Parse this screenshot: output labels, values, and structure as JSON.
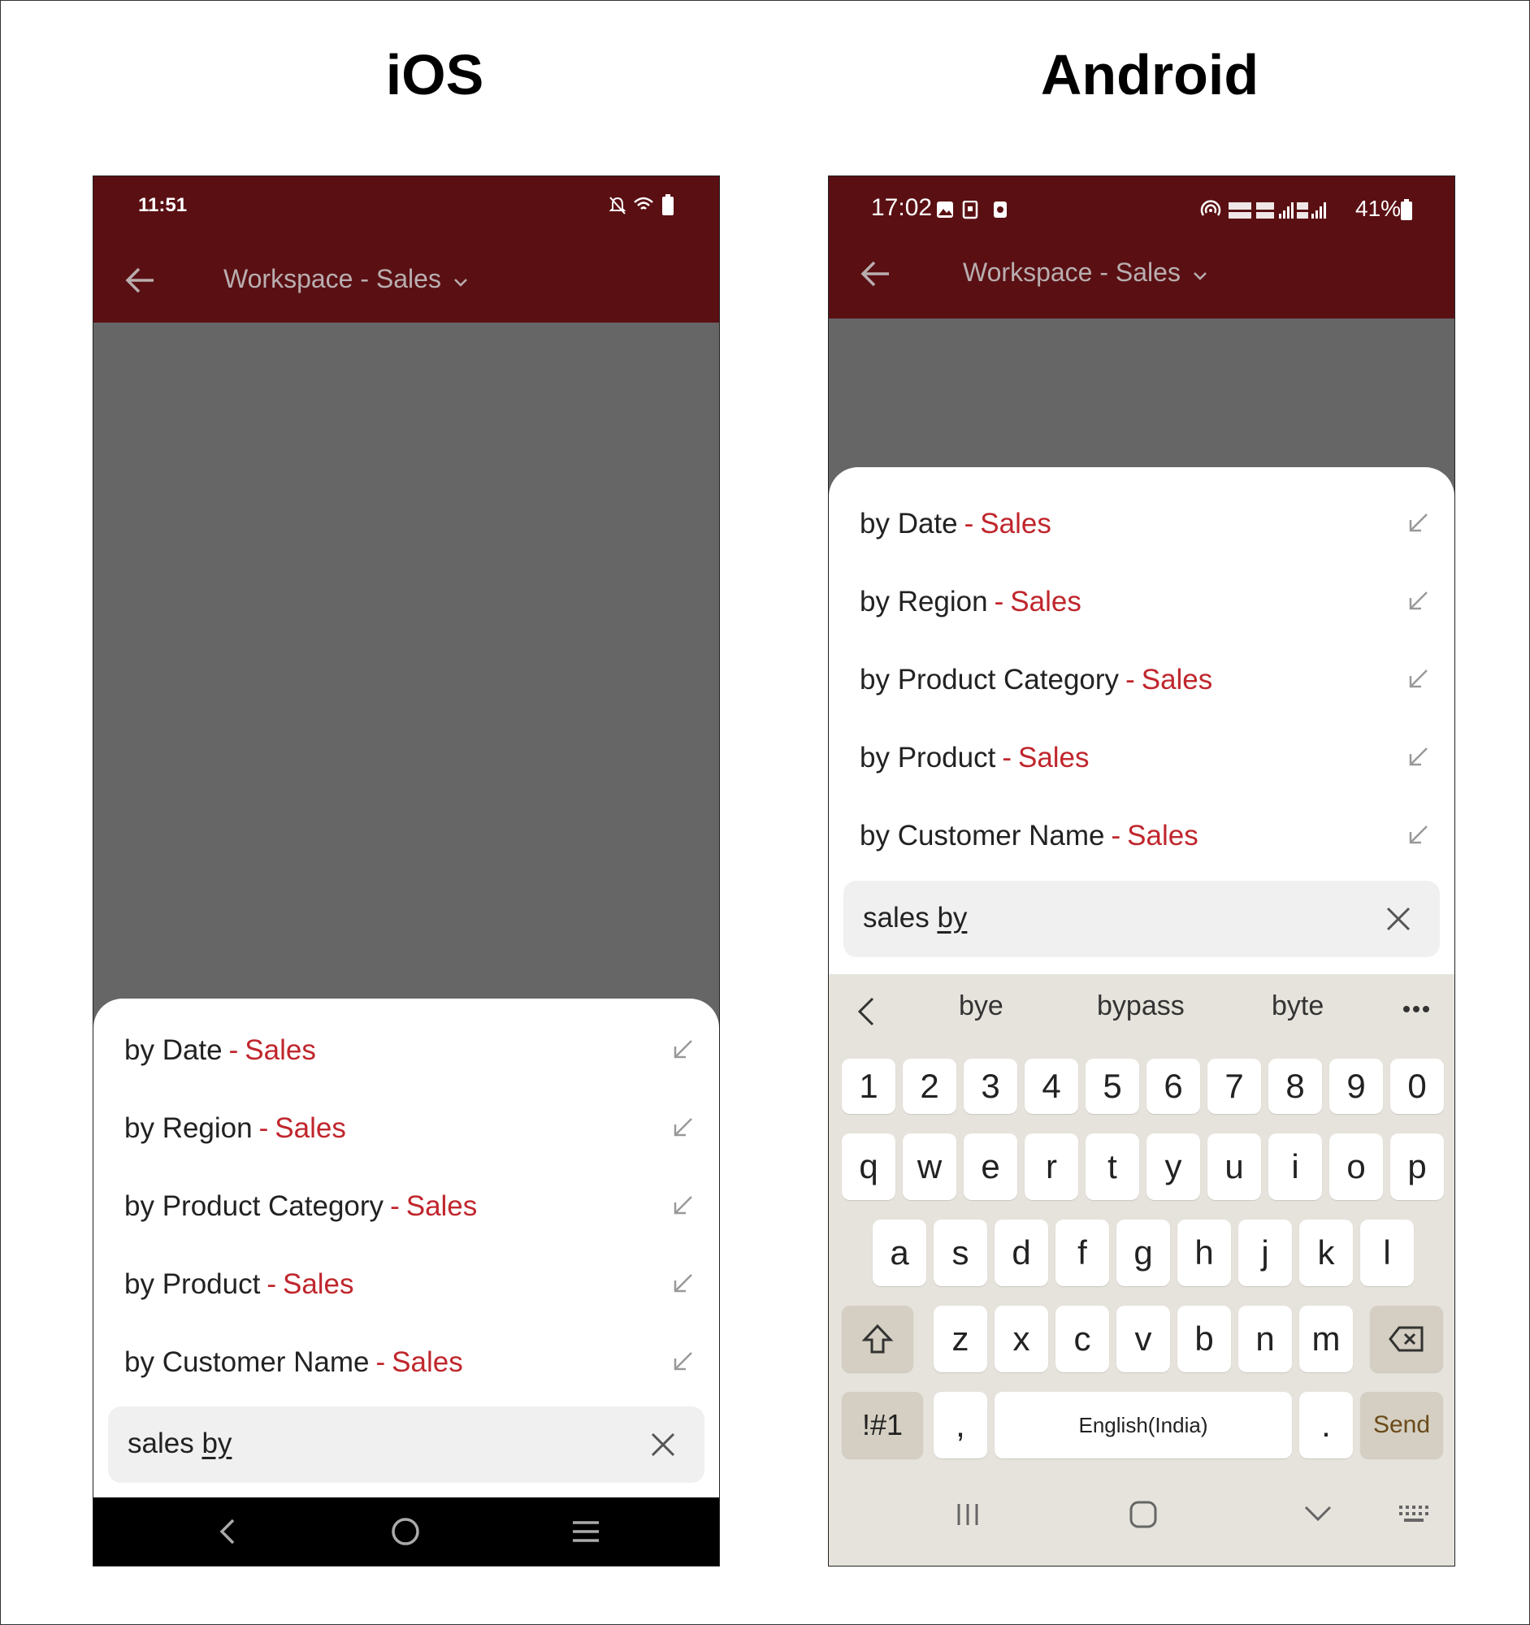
{
  "headings": {
    "ios": "iOS",
    "android": "Android"
  },
  "ios": {
    "time": "11:51",
    "title": "Workspace - Sales",
    "results": [
      {
        "label": "by Date",
        "suffix": "Sales"
      },
      {
        "label": "by Region",
        "suffix": "Sales"
      },
      {
        "label": "by Product Category",
        "suffix": "Sales"
      },
      {
        "label": "by Product",
        "suffix": "Sales"
      },
      {
        "label": "by Customer Name",
        "suffix": "Sales"
      }
    ],
    "search": {
      "prefix": "sales ",
      "underlined": "by"
    }
  },
  "android": {
    "time": "17:02",
    "battery": "41%",
    "title": "Workspace - Sales",
    "results": [
      {
        "label": "by Date",
        "suffix": "Sales"
      },
      {
        "label": "by Region",
        "suffix": "Sales"
      },
      {
        "label": "by Product Category",
        "suffix": "Sales"
      },
      {
        "label": "by Product",
        "suffix": "Sales"
      },
      {
        "label": "by Customer Name",
        "suffix": "Sales"
      }
    ],
    "search": {
      "prefix": "sales ",
      "underlined": "by"
    },
    "keyboard": {
      "suggestions": [
        "bye",
        "bypass",
        "byte"
      ],
      "numbers": [
        "1",
        "2",
        "3",
        "4",
        "5",
        "6",
        "7",
        "8",
        "9",
        "0"
      ],
      "row1": [
        "q",
        "w",
        "e",
        "r",
        "t",
        "y",
        "u",
        "i",
        "o",
        "p"
      ],
      "row2": [
        "a",
        "s",
        "d",
        "f",
        "g",
        "h",
        "j",
        "k",
        "l"
      ],
      "row3": [
        "z",
        "x",
        "c",
        "v",
        "b",
        "n",
        "m"
      ],
      "symbols": "!#1",
      "comma": ",",
      "space": "English(India)",
      "period": ".",
      "send": "Send"
    }
  },
  "colors": {
    "brand": "#5a1013",
    "accent": "#c0262d"
  }
}
